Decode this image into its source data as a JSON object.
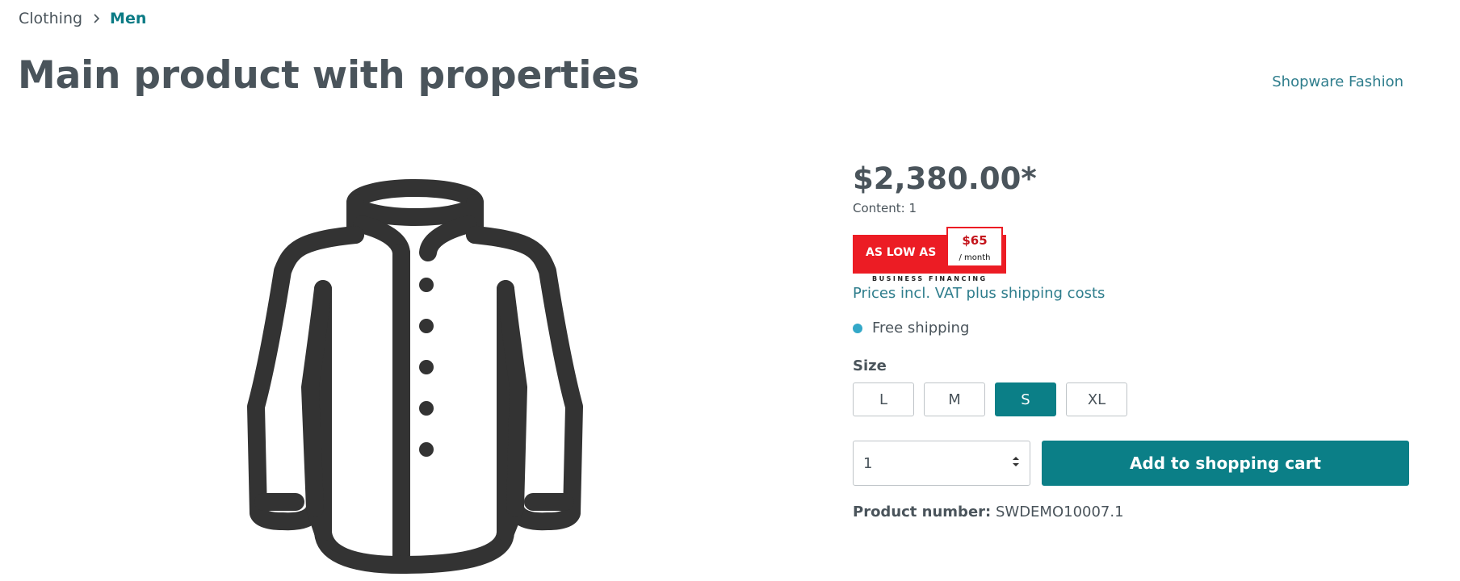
{
  "breadcrumb": {
    "items": [
      "Clothing"
    ],
    "current": "Men"
  },
  "page_title": "Main product with properties",
  "manufacturer": "Shopware Fashion",
  "product": {
    "image_icon": "jacket-icon",
    "price": "$2,380.00*",
    "content": "Content: 1",
    "financing": {
      "badge_text": "AS LOW AS",
      "amount": "$65",
      "per": "/ month",
      "caption": "BUSINESS FINANCING"
    },
    "vat_link": "Prices incl. VAT plus shipping costs",
    "shipping": "Free shipping",
    "size_label": "Size",
    "sizes": [
      "L",
      "M",
      "S",
      "XL"
    ],
    "selected_size": "S",
    "quantity": "1",
    "add_to_cart": "Add to shopping cart",
    "product_number_label": "Product number:",
    "product_number": "SWDEMO10007.1"
  },
  "colors": {
    "accent": "#0b7f87",
    "text": "#4a545b",
    "link": "#2e7d8c",
    "shipping_dot": "#33a8c8",
    "financing_red": "#ec1c24"
  }
}
